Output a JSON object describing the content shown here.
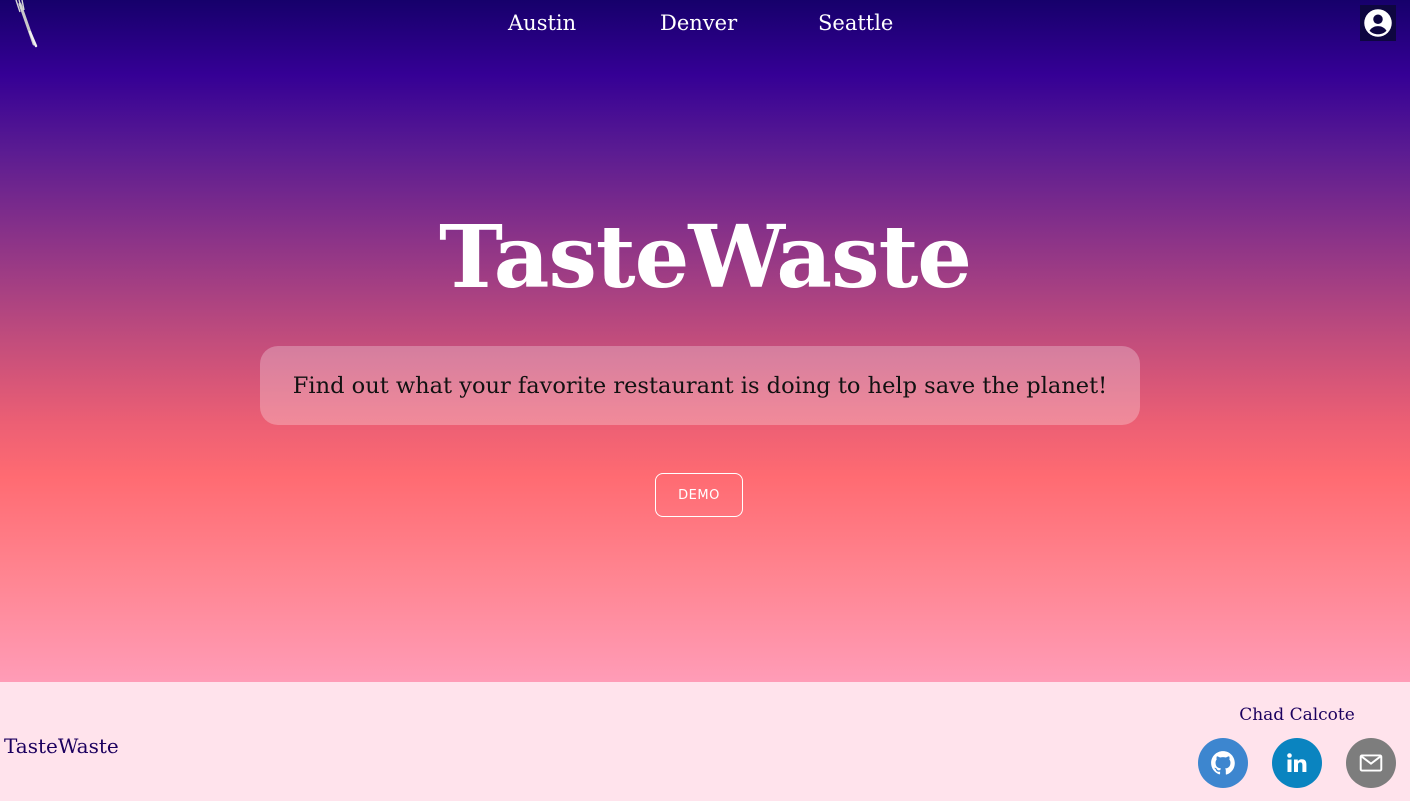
{
  "app": {
    "name": "TasteWaste"
  },
  "nav": {
    "links": [
      "Austin",
      "Denver",
      "Seattle"
    ],
    "logo_icon": "fork-icon",
    "account_icon": "account-circle-icon"
  },
  "hero": {
    "title": "TasteWaste",
    "tagline": "Find out what your favorite restaurant is doing to help save the planet!",
    "demo_label": "DEMO"
  },
  "footer": {
    "brand": "TasteWaste",
    "author": "Chad Calcote",
    "social": [
      {
        "icon": "github-icon",
        "color": "#3d86cf"
      },
      {
        "icon": "linkedin-icon",
        "color": "#0a84c0"
      },
      {
        "icon": "mail-icon",
        "color": "#7d7d7d"
      }
    ]
  },
  "colors": {
    "footer_text": "#1c005f",
    "footer_bg": "#ffe3ec",
    "hero_top": "#16006b",
    "hero_mid": "#ff6b72",
    "hero_bottom": "#ff9cb7"
  }
}
